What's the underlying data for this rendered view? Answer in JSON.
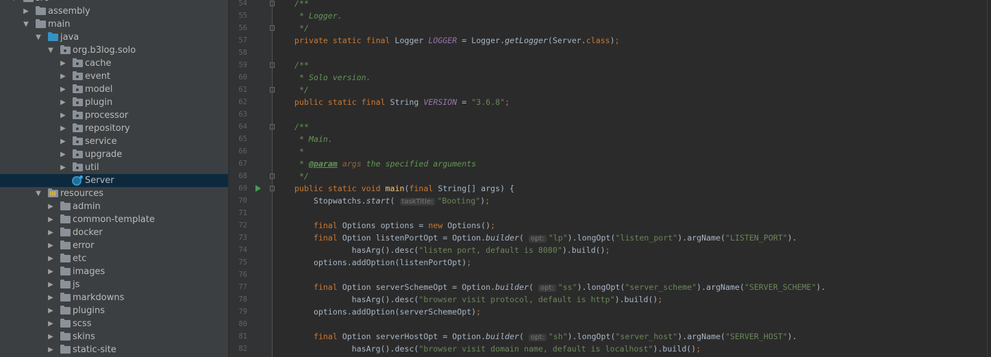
{
  "tree": [
    {
      "label": "src",
      "depth": 0,
      "arrow": "down",
      "icon": "folder"
    },
    {
      "label": "assembly",
      "depth": 1,
      "arrow": "right",
      "icon": "folder"
    },
    {
      "label": "main",
      "depth": 1,
      "arrow": "down",
      "icon": "folder"
    },
    {
      "label": "java",
      "depth": 2,
      "arrow": "down",
      "icon": "source-folder"
    },
    {
      "label": "org.b3log.solo",
      "depth": 3,
      "arrow": "down",
      "icon": "package"
    },
    {
      "label": "cache",
      "depth": 4,
      "arrow": "right",
      "icon": "package"
    },
    {
      "label": "event",
      "depth": 4,
      "arrow": "right",
      "icon": "package"
    },
    {
      "label": "model",
      "depth": 4,
      "arrow": "right",
      "icon": "package"
    },
    {
      "label": "plugin",
      "depth": 4,
      "arrow": "right",
      "icon": "package"
    },
    {
      "label": "processor",
      "depth": 4,
      "arrow": "right",
      "icon": "package"
    },
    {
      "label": "repository",
      "depth": 4,
      "arrow": "right",
      "icon": "package"
    },
    {
      "label": "service",
      "depth": 4,
      "arrow": "right",
      "icon": "package"
    },
    {
      "label": "upgrade",
      "depth": 4,
      "arrow": "right",
      "icon": "package"
    },
    {
      "label": "util",
      "depth": 4,
      "arrow": "right",
      "icon": "package"
    },
    {
      "label": "Server",
      "depth": 4,
      "arrow": "",
      "icon": "java-class",
      "selected": true
    },
    {
      "label": "resources",
      "depth": 2,
      "arrow": "down",
      "icon": "resources-folder"
    },
    {
      "label": "admin",
      "depth": 3,
      "arrow": "right",
      "icon": "folder"
    },
    {
      "label": "common-template",
      "depth": 3,
      "arrow": "right",
      "icon": "folder"
    },
    {
      "label": "docker",
      "depth": 3,
      "arrow": "right",
      "icon": "folder"
    },
    {
      "label": "error",
      "depth": 3,
      "arrow": "right",
      "icon": "folder"
    },
    {
      "label": "etc",
      "depth": 3,
      "arrow": "right",
      "icon": "folder"
    },
    {
      "label": "images",
      "depth": 3,
      "arrow": "right",
      "icon": "folder"
    },
    {
      "label": "js",
      "depth": 3,
      "arrow": "right",
      "icon": "folder"
    },
    {
      "label": "markdowns",
      "depth": 3,
      "arrow": "right",
      "icon": "folder"
    },
    {
      "label": "plugins",
      "depth": 3,
      "arrow": "right",
      "icon": "folder"
    },
    {
      "label": "scss",
      "depth": 3,
      "arrow": "right",
      "icon": "folder"
    },
    {
      "label": "skins",
      "depth": 3,
      "arrow": "right",
      "icon": "folder"
    },
    {
      "label": "static-site",
      "depth": 3,
      "arrow": "right",
      "icon": "folder"
    }
  ],
  "colors": {
    "keyword": "#cc7832",
    "comment": "#629755",
    "string": "#6a8759",
    "field": "#9876aa",
    "method": "#ffc66d",
    "text": "#a9b7c6",
    "selection": "#0d293e"
  },
  "editor": {
    "fold_lines": [
      54,
      56,
      59,
      61,
      64,
      68,
      69
    ],
    "run_line": 69,
    "lines": [
      {
        "n": "54",
        "t": [
          [
            "c",
            "    /**"
          ]
        ]
      },
      {
        "n": "55",
        "t": [
          [
            "c",
            "     * Logger."
          ]
        ]
      },
      {
        "n": "56",
        "t": [
          [
            "c",
            "     */"
          ]
        ]
      },
      {
        "n": "57",
        "t": [
          [
            "k",
            "    private static final "
          ],
          [
            "p",
            "Logger "
          ],
          [
            "f",
            "LOGGER"
          ],
          [
            "p",
            " = Logger."
          ],
          [
            "m",
            "getLogger"
          ],
          [
            "p",
            "(Server."
          ],
          [
            "k",
            "class"
          ],
          [
            "p",
            ")"
          ],
          [
            "k",
            ";"
          ]
        ]
      },
      {
        "n": "58",
        "t": []
      },
      {
        "n": "59",
        "t": [
          [
            "c",
            "    /**"
          ]
        ]
      },
      {
        "n": "60",
        "t": [
          [
            "c",
            "     * Solo version."
          ]
        ]
      },
      {
        "n": "61",
        "t": [
          [
            "c",
            "     */"
          ]
        ]
      },
      {
        "n": "62",
        "t": [
          [
            "k",
            "    public static final "
          ],
          [
            "p",
            "String "
          ],
          [
            "f",
            "VERSION"
          ],
          [
            "p",
            " = "
          ],
          [
            "s",
            "\"3.6.8\""
          ],
          [
            "k",
            ";"
          ]
        ]
      },
      {
        "n": "63",
        "t": []
      },
      {
        "n": "64",
        "t": [
          [
            "c",
            "    /**"
          ]
        ]
      },
      {
        "n": "65",
        "t": [
          [
            "c",
            "     * Main."
          ]
        ]
      },
      {
        "n": "66",
        "t": [
          [
            "c",
            "     *"
          ]
        ]
      },
      {
        "n": "67",
        "t": [
          [
            "c",
            "     * "
          ],
          [
            "tag",
            "@param"
          ],
          [
            "c",
            " "
          ],
          [
            "tv",
            "args"
          ],
          [
            "c",
            " the specified arguments"
          ]
        ]
      },
      {
        "n": "68",
        "t": [
          [
            "c",
            "     */"
          ]
        ]
      },
      {
        "n": "69",
        "t": [
          [
            "k",
            "    public static void "
          ],
          [
            "fn",
            "main"
          ],
          [
            "p",
            "("
          ],
          [
            "k",
            "final "
          ],
          [
            "p",
            "String[] args) {"
          ]
        ]
      },
      {
        "n": "70",
        "t": [
          [
            "p",
            "        Stopwatchs."
          ],
          [
            "m",
            "start"
          ],
          [
            "p",
            "( "
          ],
          [
            "h",
            "taskTitle:"
          ],
          [
            "s",
            "\"Booting\""
          ],
          [
            "p",
            ")"
          ],
          [
            "k",
            ";"
          ]
        ]
      },
      {
        "n": "71",
        "t": []
      },
      {
        "n": "72",
        "t": [
          [
            "k",
            "        final "
          ],
          [
            "p",
            "Options options = "
          ],
          [
            "k",
            "new "
          ],
          [
            "p",
            "Options()"
          ],
          [
            "k",
            ";"
          ]
        ]
      },
      {
        "n": "73",
        "t": [
          [
            "k",
            "        final "
          ],
          [
            "p",
            "Option listenPortOpt = Option."
          ],
          [
            "m",
            "builder"
          ],
          [
            "p",
            "( "
          ],
          [
            "h",
            "opt:"
          ],
          [
            "s",
            "\"lp\""
          ],
          [
            "p",
            ").longOpt("
          ],
          [
            "s",
            "\"listen_port\""
          ],
          [
            "p",
            ").argName("
          ],
          [
            "s",
            "\"LISTEN_PORT\""
          ],
          [
            "p",
            ")."
          ]
        ]
      },
      {
        "n": "74",
        "t": [
          [
            "p",
            "                hasArg().desc("
          ],
          [
            "s",
            "\"listen port, default is 8080\""
          ],
          [
            "p",
            ").build()"
          ],
          [
            "k",
            ";"
          ]
        ]
      },
      {
        "n": "75",
        "t": [
          [
            "p",
            "        options.addOption(listenPortOpt)"
          ],
          [
            "k",
            ";"
          ]
        ]
      },
      {
        "n": "76",
        "t": []
      },
      {
        "n": "77",
        "t": [
          [
            "k",
            "        final "
          ],
          [
            "p",
            "Option serverSchemeOpt = Option."
          ],
          [
            "m",
            "builder"
          ],
          [
            "p",
            "( "
          ],
          [
            "h",
            "opt:"
          ],
          [
            "s",
            "\"ss\""
          ],
          [
            "p",
            ").longOpt("
          ],
          [
            "s",
            "\"server_scheme\""
          ],
          [
            "p",
            ").argName("
          ],
          [
            "s",
            "\"SERVER_SCHEME\""
          ],
          [
            "p",
            ")."
          ]
        ]
      },
      {
        "n": "78",
        "t": [
          [
            "p",
            "                hasArg().desc("
          ],
          [
            "s",
            "\"browser visit protocol, default is http\""
          ],
          [
            "p",
            ").build()"
          ],
          [
            "k",
            ";"
          ]
        ]
      },
      {
        "n": "79",
        "t": [
          [
            "p",
            "        options.addOption(serverSchemeOpt)"
          ],
          [
            "k",
            ";"
          ]
        ]
      },
      {
        "n": "80",
        "t": []
      },
      {
        "n": "81",
        "t": [
          [
            "k",
            "        final "
          ],
          [
            "p",
            "Option serverHostOpt = Option."
          ],
          [
            "m",
            "builder"
          ],
          [
            "p",
            "( "
          ],
          [
            "h",
            "opt:"
          ],
          [
            "s",
            "\"sh\""
          ],
          [
            "p",
            ").longOpt("
          ],
          [
            "s",
            "\"server_host\""
          ],
          [
            "p",
            ").argName("
          ],
          [
            "s",
            "\"SERVER_HOST\""
          ],
          [
            "p",
            ")."
          ]
        ]
      },
      {
        "n": "82",
        "t": [
          [
            "p",
            "                hasArg().desc("
          ],
          [
            "s",
            "\"browser visit domain name, default is localhost\""
          ],
          [
            "p",
            ").build()"
          ],
          [
            "k",
            ";"
          ]
        ]
      }
    ]
  }
}
